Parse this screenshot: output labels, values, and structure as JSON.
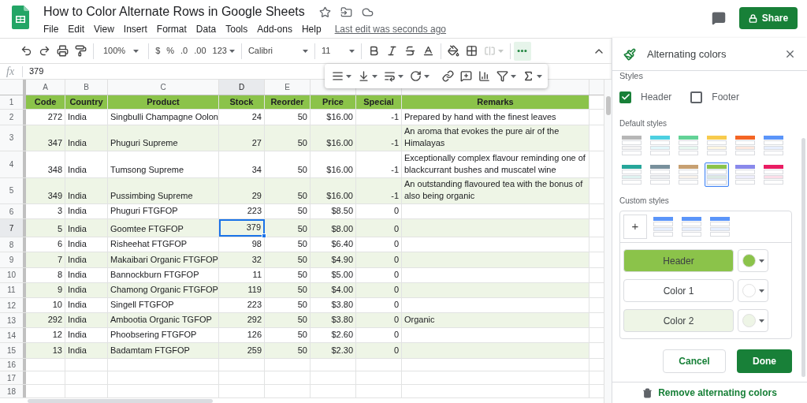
{
  "app_bar": {
    "title": "How to Color Alternate Rows in Google Sheets",
    "menus": [
      "File",
      "Edit",
      "View",
      "Insert",
      "Format",
      "Data",
      "Tools",
      "Add-ons",
      "Help"
    ],
    "last_edit": "Last edit was seconds ago",
    "share": "Share"
  },
  "toolbar": {
    "zoom": "100%",
    "currency": "$",
    "percent": "%",
    "decrease_decimals": ".0",
    "increase_decimals": ".00",
    "number_format": "123",
    "font": "Calibri",
    "font_size": "11",
    "merge_cells": {
      "disabled": true
    },
    "more": {
      "selected": true
    }
  },
  "formula_bar": {
    "label": "fx",
    "value": "379"
  },
  "sheet": {
    "columns": [
      {
        "letter": "A",
        "selected": false
      },
      {
        "letter": "B",
        "selected": false
      },
      {
        "letter": "C",
        "selected": false
      },
      {
        "letter": "D",
        "selected": true
      },
      {
        "letter": "E",
        "selected": false
      },
      {
        "selected": false
      },
      {
        "selected": false
      },
      {
        "selected": false
      }
    ],
    "header_number": "1",
    "header": [
      "Code",
      "Country",
      "Product",
      "Stock",
      "Reorder",
      "Price",
      "Special",
      "Remarks"
    ],
    "rows": [
      {
        "number": "2",
        "selected": false,
        "cells": [
          "272",
          "India",
          "Singbulli Champagne Oolon",
          "24",
          "50",
          "$16.00",
          "-1",
          "Prepared by hand with the finest leaves"
        ]
      },
      {
        "number": "3",
        "selected": false,
        "cells": [
          "347",
          "India",
          "Phuguri Supreme",
          "27",
          "50",
          "$16.00",
          "-1",
          "An aroma that evokes the pure air of the Himalayas"
        ]
      },
      {
        "number": "4",
        "selected": false,
        "cells": [
          "348",
          "India",
          "Tumsong Supreme",
          "34",
          "50",
          "$16.00",
          "-1",
          "Exceptionally complex flavour reminding one of blackcurrant bushes and muscatel wine"
        ]
      },
      {
        "number": "5",
        "selected": false,
        "cells": [
          "349",
          "India",
          "Pussimbing Supreme",
          "29",
          "50",
          "$16.00",
          "-1",
          "An outstanding flavoured tea with the bonus of also being organic"
        ]
      },
      {
        "number": "6",
        "selected": false,
        "cells": [
          "3",
          "India",
          "Phuguri FTGFOP",
          "223",
          "50",
          "$8.50",
          "0",
          ""
        ]
      },
      {
        "number": "7",
        "selected": true,
        "cells": [
          "5",
          "India",
          "Goomtee FTGFOP",
          "379",
          "50",
          "$8.00",
          "0",
          ""
        ]
      },
      {
        "number": "8",
        "selected": false,
        "cells": [
          "6",
          "India",
          "Risheehat FTGFOP",
          "98",
          "50",
          "$6.40",
          "0",
          ""
        ]
      },
      {
        "number": "9",
        "selected": false,
        "cells": [
          "7",
          "India",
          "Makaibari Organic FTGFOP",
          "32",
          "50",
          "$4.90",
          "0",
          ""
        ]
      },
      {
        "number": "10",
        "selected": false,
        "cells": [
          "8",
          "India",
          "Bannockburn FTGFOP",
          "11",
          "50",
          "$5.00",
          "0",
          ""
        ]
      },
      {
        "number": "11",
        "selected": false,
        "cells": [
          "9",
          "India",
          "Chamong Organic FTGFOP",
          "119",
          "50",
          "$4.00",
          "0",
          ""
        ]
      },
      {
        "number": "12",
        "selected": false,
        "cells": [
          "10",
          "India",
          "Singell FTGFOP",
          "223",
          "50",
          "$3.80",
          "0",
          ""
        ]
      },
      {
        "number": "13",
        "selected": false,
        "cells": [
          "292",
          "India",
          "Ambootia Organic TGFOP",
          "292",
          "50",
          "$3.80",
          "0",
          "Organic"
        ]
      },
      {
        "number": "14",
        "selected": false,
        "cells": [
          "12",
          "India",
          "Phoobsering FTGFOP",
          "126",
          "50",
          "$2.60",
          "0",
          ""
        ]
      },
      {
        "number": "15",
        "selected": false,
        "cells": [
          "13",
          "India",
          "Badamtam FTGFOP",
          "259",
          "50",
          "$2.30",
          "0",
          ""
        ]
      }
    ],
    "empty_rows": [
      "16",
      "17",
      "18"
    ]
  },
  "sidebar": {
    "title": "Alternating colors",
    "section": "Styles",
    "options": [
      {
        "label": "Header",
        "checked": true
      },
      {
        "label": "Footer",
        "checked": false
      }
    ],
    "default_styles_label": "Default styles",
    "default_styles": [
      {
        "color": "#b7b7b7",
        "selected": false
      },
      {
        "color": "#4dd0e1",
        "selected": false
      },
      {
        "color": "#63d297",
        "selected": false
      },
      {
        "color": "#f7cb4d",
        "selected": false
      },
      {
        "color": "#f46524",
        "selected": false
      },
      {
        "color": "#5b95f9",
        "selected": false
      },
      {
        "color": "#26a69a",
        "selected": false
      },
      {
        "color": "#78909c",
        "selected": false
      },
      {
        "color": "#c7a071",
        "selected": false
      },
      {
        "color": "#8bc34a",
        "selected": true
      },
      {
        "color": "#8989eb",
        "selected": false
      },
      {
        "color": "#e91d63",
        "selected": false
      }
    ],
    "custom_styles_label": "Custom styles",
    "add": "+",
    "presets": [
      {
        "color": "#5b95f9"
      },
      {
        "color": "#5b95f9"
      },
      {
        "color": "#5b95f9"
      }
    ],
    "color_rows": [
      {
        "label": "Header",
        "color": "#8bc34a"
      },
      {
        "label": "Color 1",
        "color": "#ffffff"
      },
      {
        "label": "Color 2",
        "color": "#eef5e6"
      }
    ],
    "cancel": "Cancel",
    "done": "Done",
    "remove": "Remove alternating colors"
  }
}
